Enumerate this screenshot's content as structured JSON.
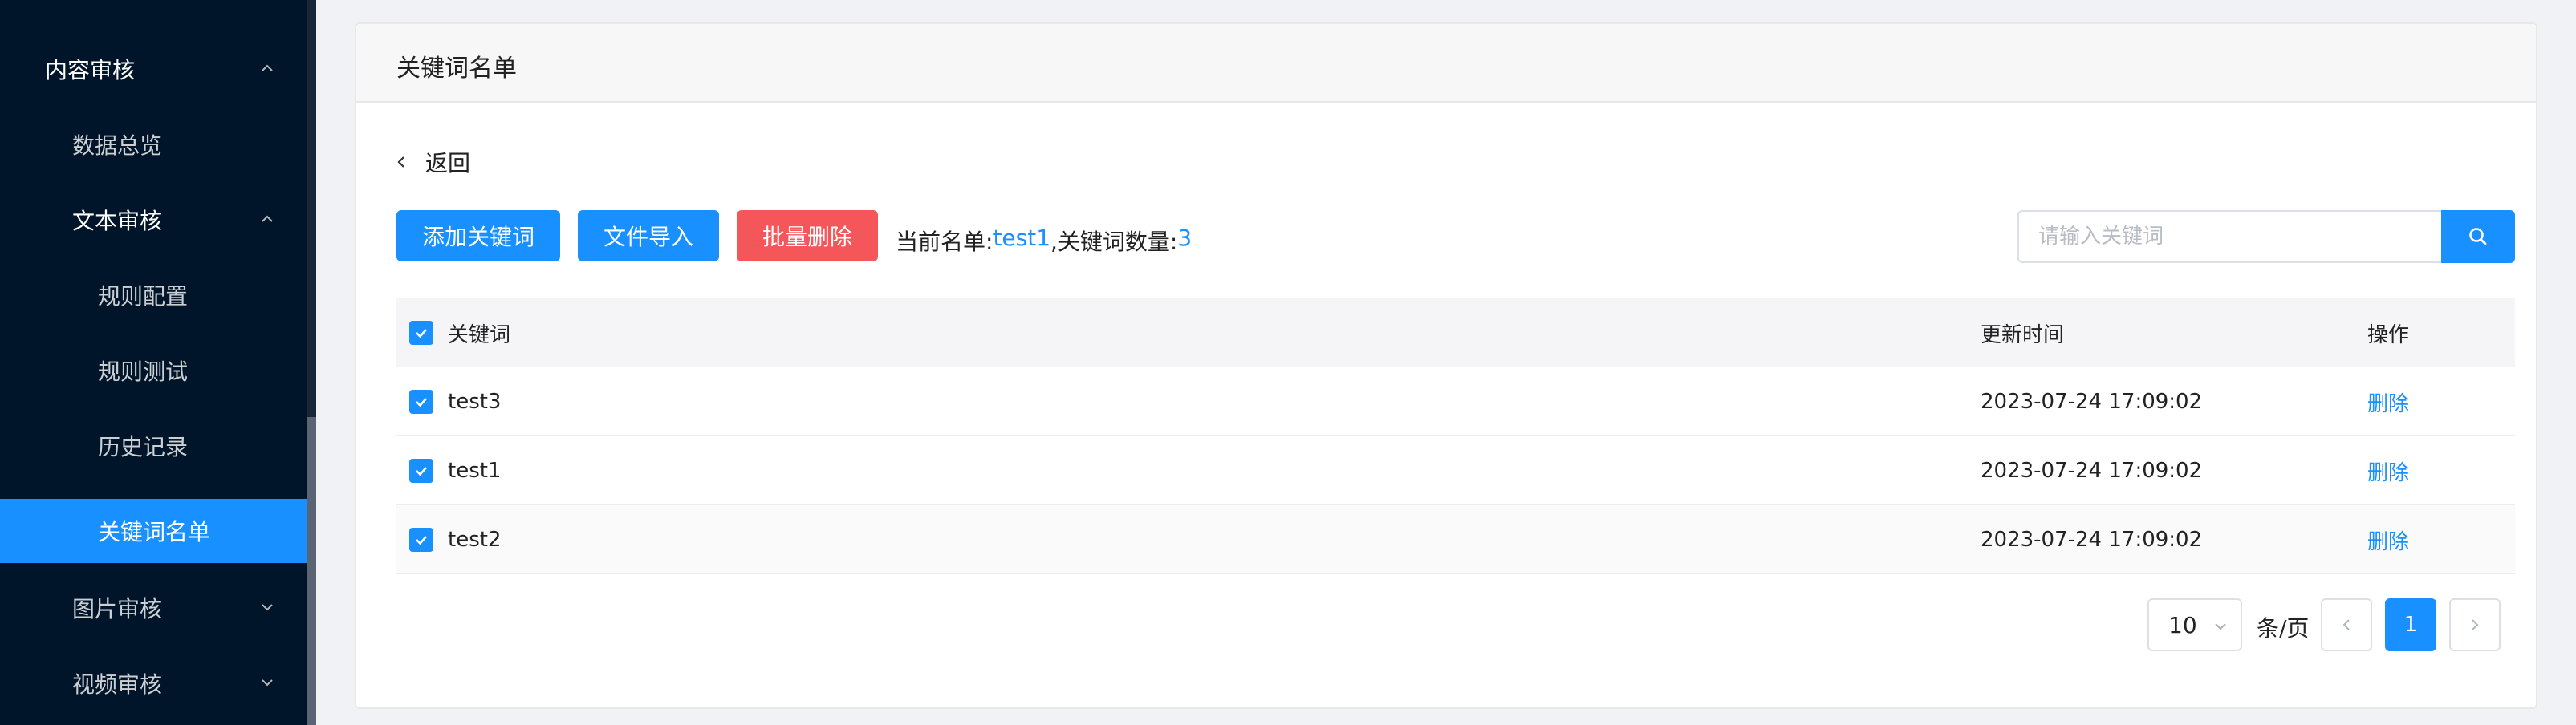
{
  "sidebar": {
    "items": [
      {
        "label": "内容审核",
        "level": 1,
        "arrow": "up"
      },
      {
        "label": "数据总览",
        "level": 2
      },
      {
        "label": "文本审核",
        "level": 2,
        "arrow": "up"
      },
      {
        "label": "规则配置",
        "level": 3
      },
      {
        "label": "规则测试",
        "level": 3
      },
      {
        "label": "历史记录",
        "level": 3
      },
      {
        "label": "关键词名单",
        "level": 3,
        "active": true
      },
      {
        "label": "图片审核",
        "level": 2,
        "arrow": "down"
      },
      {
        "label": "视频审核",
        "level": 2,
        "arrow": "down"
      }
    ]
  },
  "card": {
    "title": "关键词名单"
  },
  "back": {
    "label": "返回"
  },
  "toolbar": {
    "add_label": "添加关键词",
    "import_label": "文件导入",
    "batch_delete_label": "批量删除",
    "current_list_label": "当前名单: ",
    "current_list_value": "test1",
    "keyword_count_label": ",关键词数量: ",
    "keyword_count_value": "3"
  },
  "search": {
    "placeholder": "请输入关键词",
    "value": ""
  },
  "table": {
    "columns": {
      "keyword": "关键词",
      "updated": "更新时间",
      "action": "操作"
    },
    "rows": [
      {
        "keyword": "test3",
        "updated": "2023-07-24 17:09:02",
        "action": "删除",
        "checked": true
      },
      {
        "keyword": "test1",
        "updated": "2023-07-24 17:09:02",
        "action": "删除",
        "checked": true
      },
      {
        "keyword": "test2",
        "updated": "2023-07-24 17:09:02",
        "action": "删除",
        "checked": true
      }
    ]
  },
  "pagination": {
    "page_size": "10",
    "per_page_label": "条/页",
    "current_page": "1"
  },
  "colors": {
    "accent": "#1890ff",
    "danger": "#f5565a",
    "sidebar_bg": "#001529"
  }
}
